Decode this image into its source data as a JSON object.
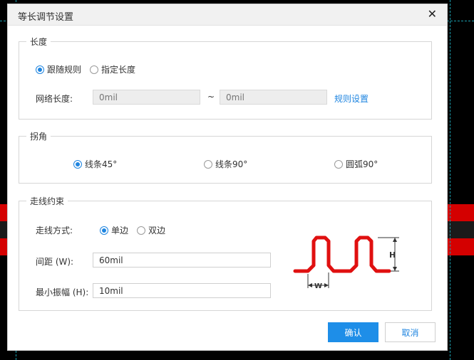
{
  "dialog": {
    "title": "等长调节设置",
    "close_icon": "close-icon"
  },
  "length_group": {
    "legend": "长度",
    "options": [
      {
        "label": "跟随规则",
        "selected": true
      },
      {
        "label": "指定长度",
        "selected": false
      }
    ],
    "net_length_label": "网络长度:",
    "min_placeholder": "0mil",
    "tilde": "~",
    "max_placeholder": "0mil",
    "rule_settings_link": "规则设置"
  },
  "corner_group": {
    "legend": "拐角",
    "options": [
      {
        "label": "线条45°",
        "selected": true
      },
      {
        "label": "线条90°",
        "selected": false
      },
      {
        "label": "圆弧90°",
        "selected": false
      }
    ]
  },
  "routing_group": {
    "legend": "走线约束",
    "mode_label": "走线方式:",
    "mode_options": [
      {
        "label": "单边",
        "selected": true
      },
      {
        "label": "双边",
        "selected": false
      }
    ],
    "spacing_label": "间距 (W):",
    "spacing_value": "60mil",
    "amplitude_label": "最小振幅 (H):",
    "amplitude_value": "10mil",
    "diagram": {
      "w_label": "W",
      "h_label": "H",
      "trace_color": "#e01010"
    }
  },
  "buttons": {
    "confirm": "确认",
    "cancel": "取消"
  }
}
